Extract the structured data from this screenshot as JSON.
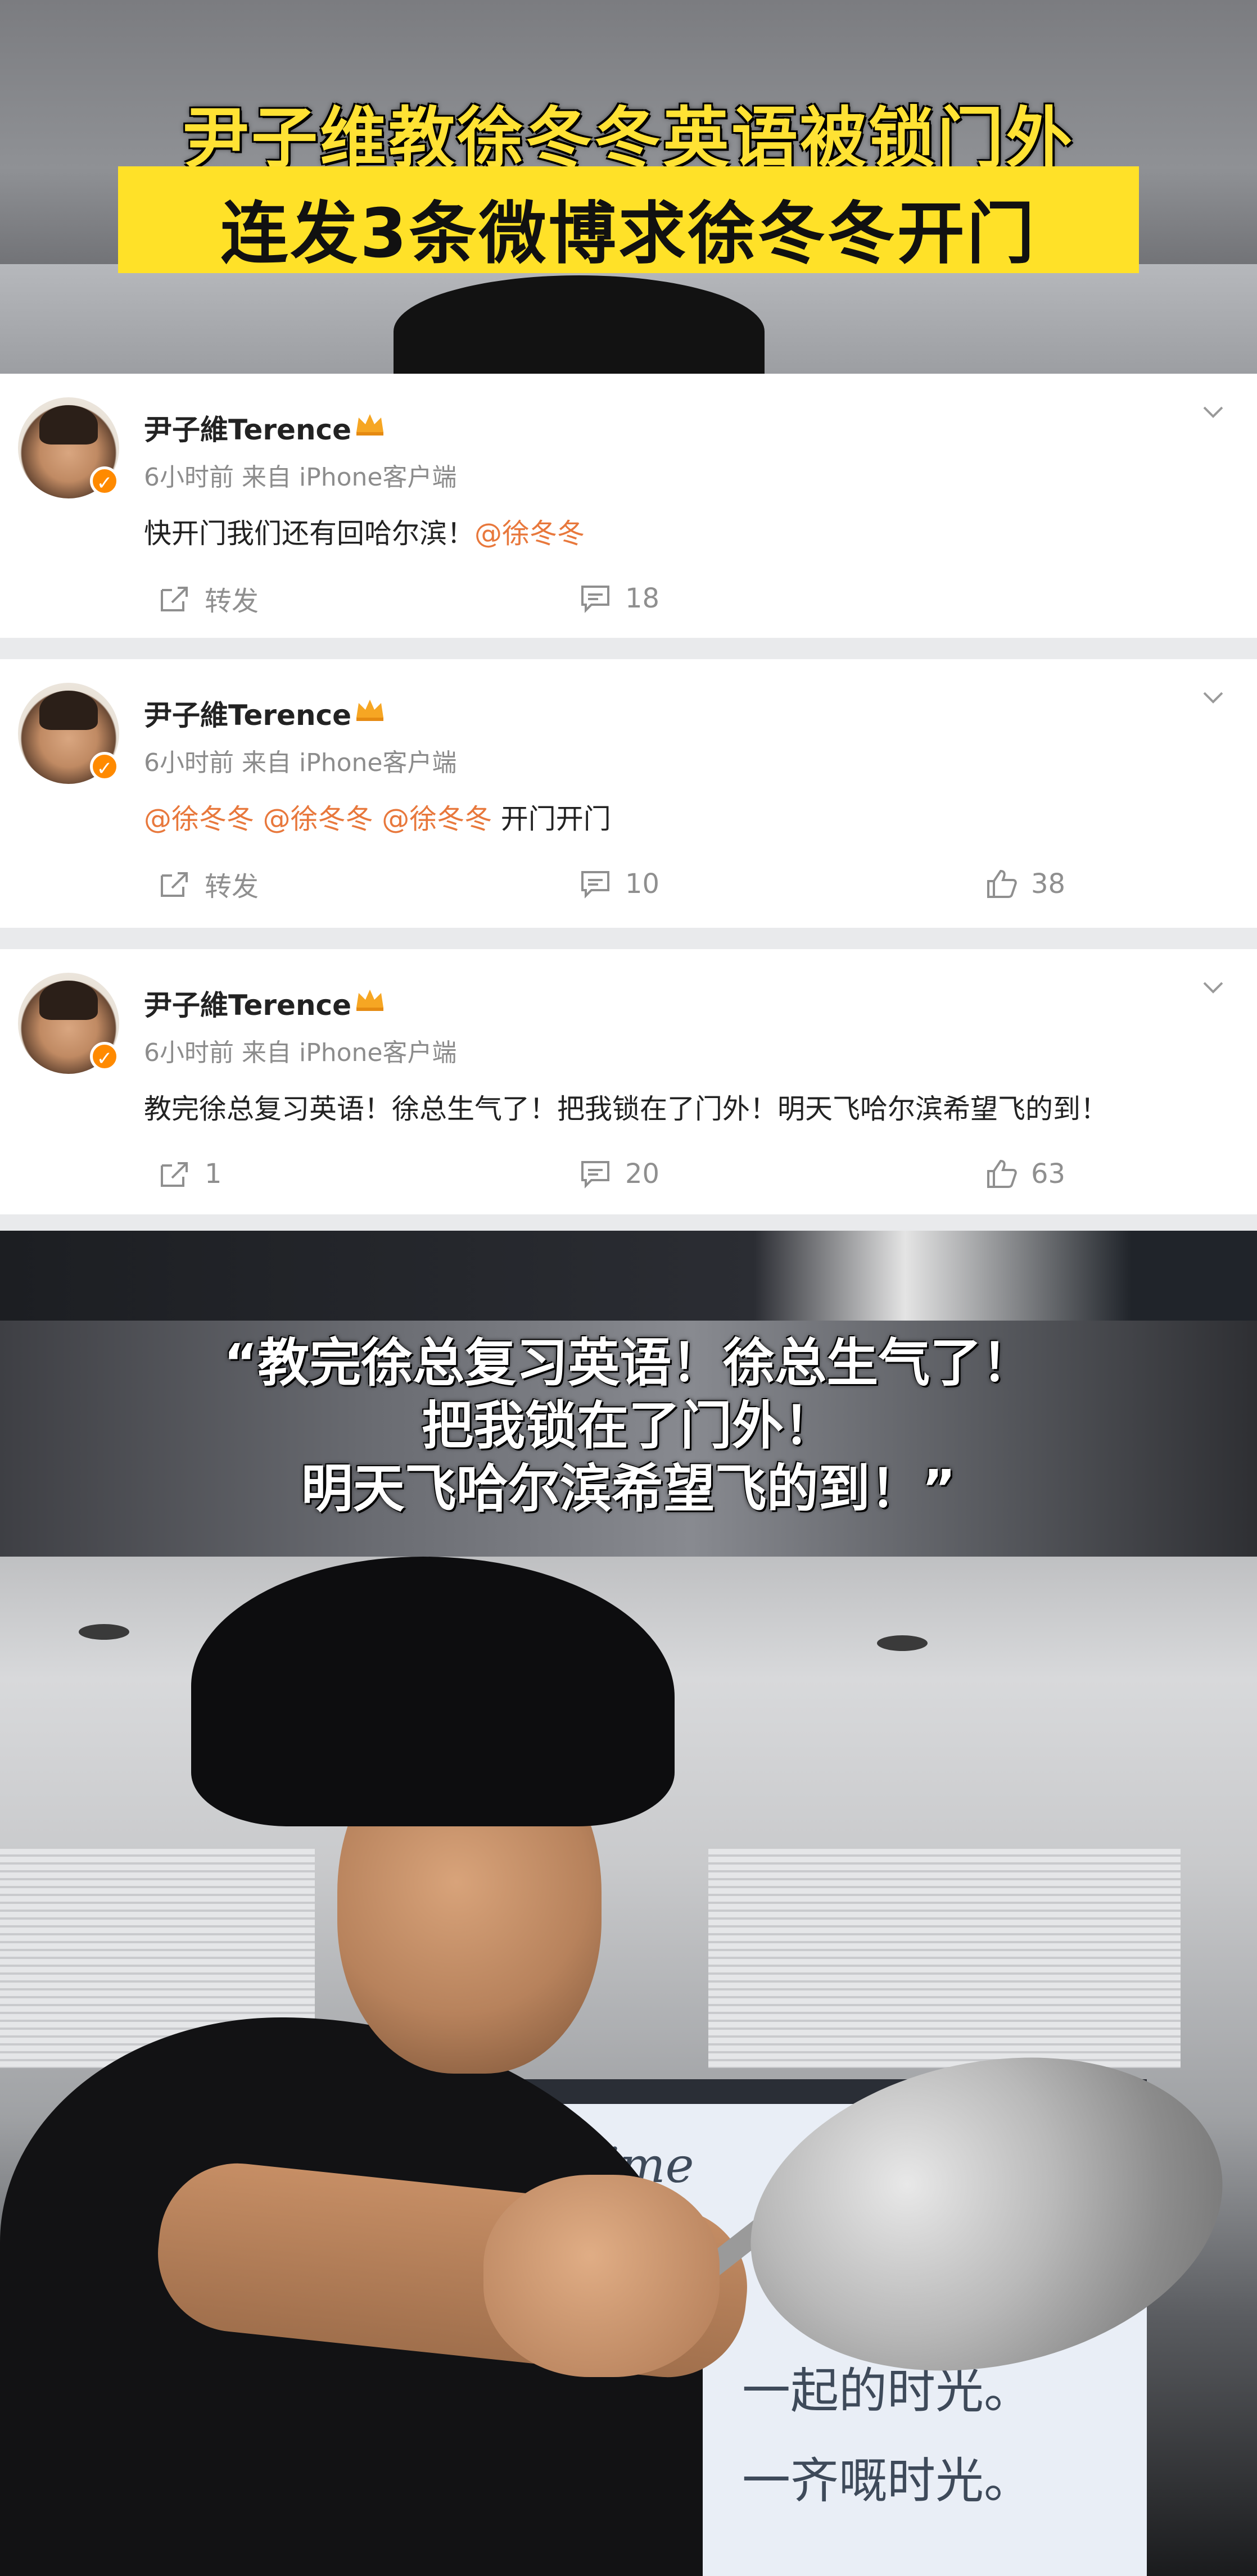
{
  "banner": {
    "headline": "尹子维教徐冬冬英语被锁门外",
    "subheadline": "连发3条微博求徐冬冬开门"
  },
  "posts": [
    {
      "username": "尹子維Terence",
      "meta": "6小时前 来自 iPhone客户端",
      "text": "快开门我们还有回哈尔滨！",
      "mentions": [
        "@徐冬冬"
      ],
      "share_label": "转发",
      "comment_count": "18",
      "like_count": ""
    },
    {
      "username": "尹子維Terence",
      "meta": "6小时前 来自 iPhone客户端",
      "text": "开门开门",
      "mentions": [
        "@徐冬冬",
        "@徐冬冬",
        "@徐冬冬"
      ],
      "share_label": "转发",
      "comment_count": "10",
      "like_count": "38"
    },
    {
      "username": "尹子維Terence",
      "meta": "6小时前 来自 iPhone客户端",
      "text": "教完徐总复习英语！徐总生气了！把我锁在了门外！明天飞哈尔滨希望飞的到！",
      "mentions": [],
      "share_label": "1",
      "comment_count": "20",
      "like_count": "63"
    }
  ],
  "quote": {
    "line1": "“教完徐总复习英语！徐总生气了！",
    "line2": "把我锁在了门外！",
    "line3": "明天飞哈尔滨希望飞的到！”"
  },
  "photo": {
    "screen_line1": "一起的时光。",
    "screen_line2": "一齐嘅时光。",
    "screen_fragment": "time"
  },
  "colors": {
    "headline": "#ffe234",
    "subhead_bg": "#ffe128",
    "mention": "#e8783c",
    "verified_badge": "#ff8a00"
  }
}
